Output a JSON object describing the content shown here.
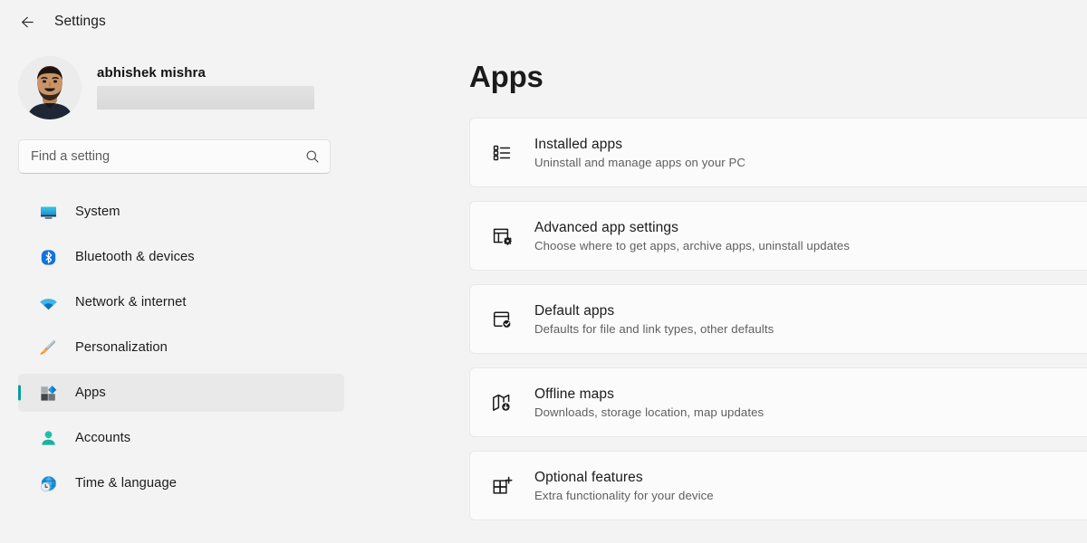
{
  "window": {
    "app_title": "Settings",
    "back_icon": "back-arrow-icon"
  },
  "sidebar": {
    "account": {
      "name": "abhishek mishra",
      "email_redacted": "",
      "avatar_icon": "user-photo-avatar"
    },
    "search": {
      "placeholder": "Find a setting",
      "value": "",
      "icon": "search-icon"
    },
    "items": [
      {
        "label": "System",
        "icon": "monitor-icon",
        "selected": false
      },
      {
        "label": "Bluetooth & devices",
        "icon": "bluetooth-icon",
        "selected": false
      },
      {
        "label": "Network & internet",
        "icon": "wifi-icon",
        "selected": false
      },
      {
        "label": "Personalization",
        "icon": "paintbrush-icon",
        "selected": false
      },
      {
        "label": "Apps",
        "icon": "apps-blocks-icon",
        "selected": true
      },
      {
        "label": "Accounts",
        "icon": "person-icon",
        "selected": false
      },
      {
        "label": "Time & language",
        "icon": "globe-clock-icon",
        "selected": false
      }
    ]
  },
  "main": {
    "page_title": "Apps",
    "cards": [
      {
        "title": "Installed apps",
        "subtitle": "Uninstall and manage apps on your PC",
        "icon": "list-items-icon"
      },
      {
        "title": "Advanced app settings",
        "subtitle": "Choose where to get apps, archive apps, uninstall updates",
        "icon": "app-window-gear-icon"
      },
      {
        "title": "Default apps",
        "subtitle": "Defaults for file and link types, other defaults",
        "icon": "window-checkmark-icon"
      },
      {
        "title": "Offline maps",
        "subtitle": "Downloads, storage location, map updates",
        "icon": "map-download-icon"
      },
      {
        "title": "Optional features",
        "subtitle": "Extra functionality for your device",
        "icon": "grid-plus-icon"
      }
    ]
  },
  "colors": {
    "page_background": "#f3f3f3",
    "card_background": "#fbfbfb",
    "accent_selected": "#0f9b9b",
    "selected_row": "#e9e9e9",
    "text_primary": "#1b1b1b",
    "text_secondary": "#5f5f5f"
  }
}
